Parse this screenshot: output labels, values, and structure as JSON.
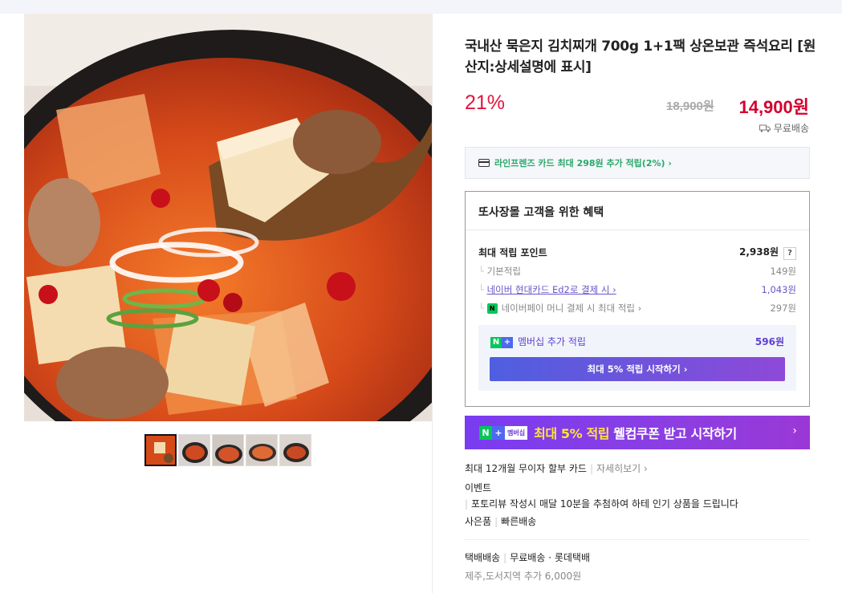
{
  "product": {
    "title": "국내산 묵은지 김치찌개 700g 1+1팩 상온보관 즉석요리 [원산지:상세설명에 표시]",
    "discount_rate": "21%",
    "original_price": "18,900원",
    "sale_price": "14,900원",
    "shipping": "무료배송"
  },
  "card_promo": {
    "text": "라인프렌즈 카드 최대 298원 추가 적립(2%) ›"
  },
  "benefits": {
    "heading": "또사장몰 고객을 위한 혜택",
    "max_points_label": "최대 적립 포인트",
    "max_points_value": "2,938원",
    "help": "?",
    "rows": [
      {
        "label": "기본적립",
        "value": "149원"
      },
      {
        "label": "네이버 현대카드 Ed2로 결제 시 ›",
        "value": "1,043원"
      },
      {
        "label": "네이버페이 머니 결제 시 최대 적립 ›",
        "value": "297원"
      }
    ],
    "membership": {
      "label": "멤버십 추가 적립",
      "value": "596원",
      "button": "최대 5% 적립 시작하기 ›"
    }
  },
  "promo_banner": {
    "badge_n": "N",
    "badge_plus": "+",
    "badge_text": "멤버십",
    "highlight": "최대 5% 적립",
    "text": " 웰컴쿠폰 받고 시작하기",
    "arrow": "›"
  },
  "extra_info": {
    "installment": "최대 12개월 무이자 할부 카드",
    "installment_link": "자세히보기 ›",
    "event_label": "이벤트",
    "event_text": "포토리뷰 작성시 매달 10분을 추첨하여 하테 인기 상품을 드립니다",
    "gift_label": "사은품",
    "gift_text": "빠른배송",
    "delivery_type": "택배배송",
    "delivery_free": "무료배송",
    "delivery_carrier": "· 롯데택배",
    "extra_fee": "제주,도서지역 추가 6,000원"
  },
  "colors": {
    "price_red": "#d4002e",
    "discount_red": "#e1163f",
    "naver_green": "#03c75a",
    "membership_purple": "#5d3fd3"
  }
}
